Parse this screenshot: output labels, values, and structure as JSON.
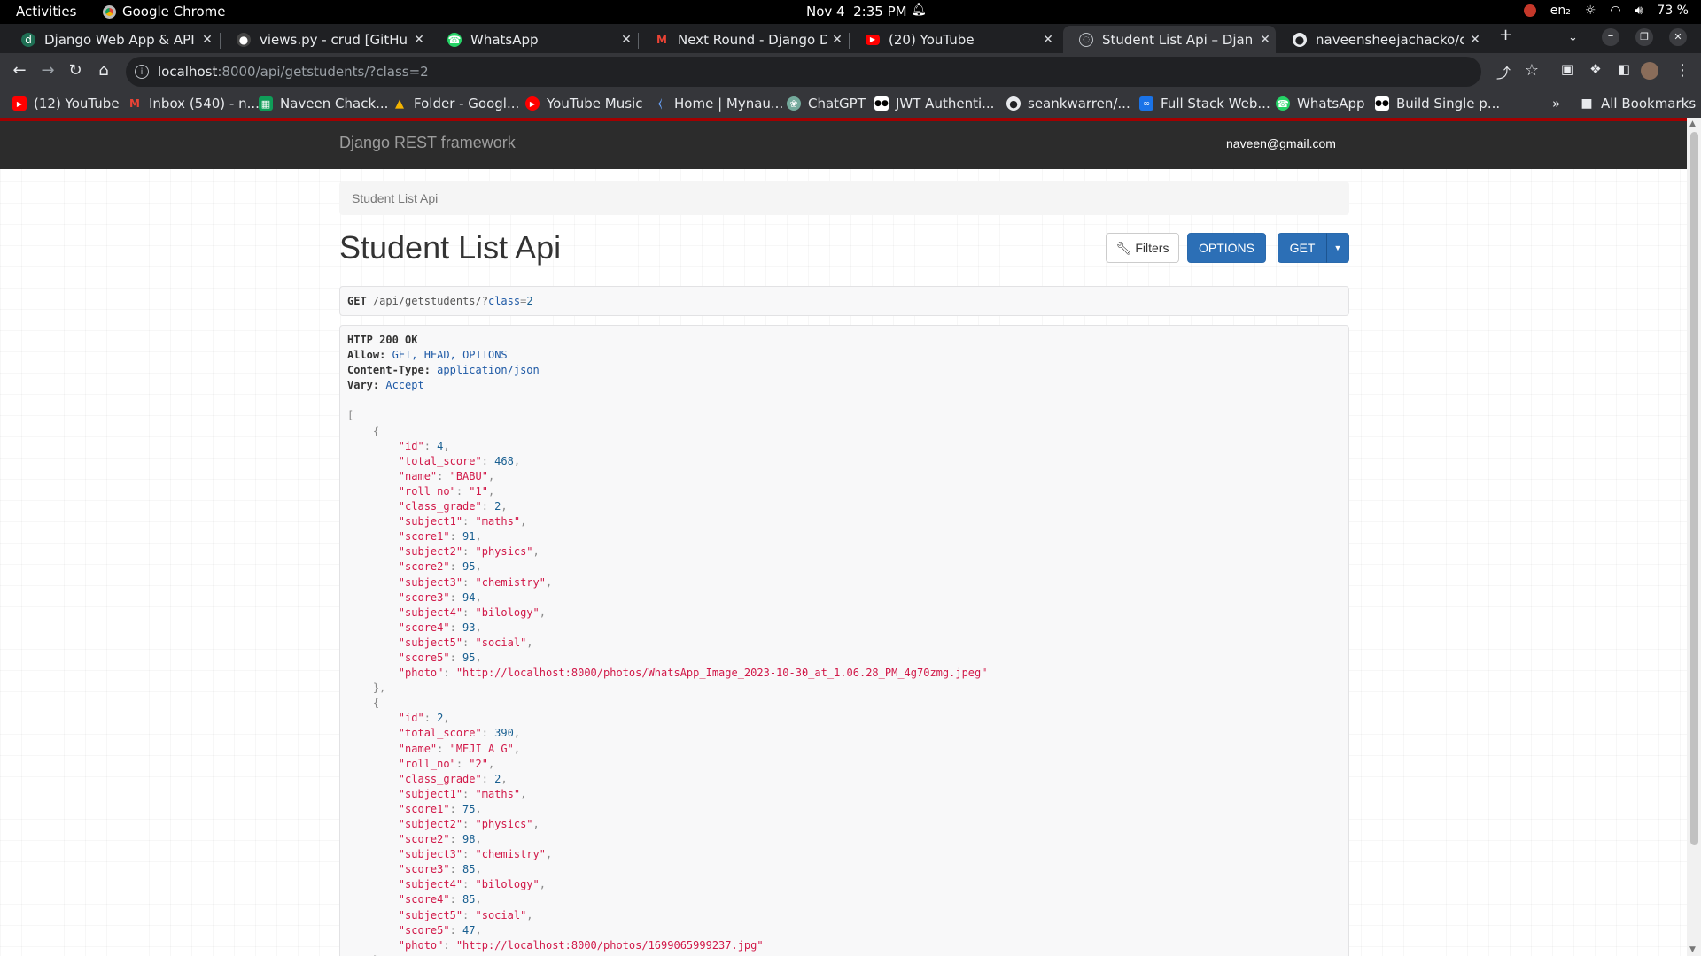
{
  "system_bar": {
    "activities": "Activities",
    "app": "Google Chrome",
    "date": "Nov 4",
    "time": "2:35 PM",
    "lang": "en₂",
    "battery": "73 %"
  },
  "tabs": [
    {
      "title": "Django Web App & API",
      "icon": "django-icon",
      "active": false
    },
    {
      "title": "views.py - crud [GitHub] -",
      "icon": "github-icon",
      "active": false
    },
    {
      "title": "WhatsApp",
      "icon": "whatsapp-icon",
      "active": false
    },
    {
      "title": "Next Round - Django Dev",
      "icon": "gmail-icon",
      "active": false
    },
    {
      "title": "(20) YouTube",
      "icon": "youtube-icon",
      "active": false
    },
    {
      "title": "Student List Api – Django",
      "icon": "globe-icon",
      "active": true
    },
    {
      "title": "naveensheejachacko/cor",
      "icon": "github-icon",
      "active": false
    }
  ],
  "address_bar": {
    "host": "localhost",
    "path": ":8000/api/getstudents/?class=2"
  },
  "bookmarks": [
    {
      "label": "(12) YouTube",
      "icon": "youtube-icon",
      "color": "#ff0000"
    },
    {
      "label": "Inbox (540) - n...",
      "icon": "gmail-icon",
      "color": "#d93025"
    },
    {
      "label": "Naveen Chack...",
      "icon": "sheets-icon",
      "color": "#0f9d58"
    },
    {
      "label": "Folder - Googl...",
      "icon": "drive-icon",
      "color": "#f4b400"
    },
    {
      "label": "YouTube Music",
      "icon": "youtube-music-icon",
      "color": "#ff0000"
    },
    {
      "label": "Home | Mynau...",
      "icon": "mynaukri-icon",
      "color": "#3b82f6"
    },
    {
      "label": "ChatGPT",
      "icon": "chatgpt-icon",
      "color": "#74aa9c"
    },
    {
      "label": "JWT Authenti...",
      "icon": "medium-icon",
      "color": "#000000"
    },
    {
      "label": "seankwarren/...",
      "icon": "github-icon",
      "color": "#000000"
    },
    {
      "label": "Full Stack Web...",
      "icon": "coursera-icon",
      "color": "#1a73e8"
    },
    {
      "label": "WhatsApp",
      "icon": "whatsapp-icon",
      "color": "#25d366"
    },
    {
      "label": "Build Single p...",
      "icon": "medium-icon",
      "color": "#000000"
    }
  ],
  "all_bookmarks": "All Bookmarks",
  "drf": {
    "brand": "Django REST framework",
    "user": "naveen@gmail.com",
    "breadcrumb": "Student List Api",
    "title": "Student List Api",
    "filters_label": "Filters",
    "options_label": "OPTIONS",
    "get_label": "GET",
    "request": {
      "method": "GET",
      "path": "/api/getstudents/?",
      "param_key": "class",
      "param_val": "2"
    },
    "response": {
      "status": "HTTP 200 OK",
      "headers": [
        {
          "name": "Allow:",
          "value": "GET, HEAD, OPTIONS"
        },
        {
          "name": "Content-Type:",
          "value": "application/json"
        },
        {
          "name": "Vary:",
          "value": "Accept"
        }
      ],
      "students": [
        {
          "id": "4",
          "total_score": "468",
          "name": "\"BABU\"",
          "roll_no": "\"1\"",
          "class_grade": "2",
          "subject1": "\"maths\"",
          "score1": "91",
          "subject2": "\"physics\"",
          "score2": "95",
          "subject3": "\"chemistry\"",
          "score3": "94",
          "subject4": "\"bilology\"",
          "score4": "93",
          "subject5": "\"social\"",
          "score5": "95",
          "photo": "\"http://localhost:8000/photos/WhatsApp_Image_2023-10-30_at_1.06.28_PM_4g70zmg.jpeg\""
        },
        {
          "id": "2",
          "total_score": "390",
          "name": "\"MEJI A G\"",
          "roll_no": "\"2\"",
          "class_grade": "2",
          "subject1": "\"maths\"",
          "score1": "75",
          "subject2": "\"physics\"",
          "score2": "98",
          "subject3": "\"chemistry\"",
          "score3": "85",
          "subject4": "\"bilology\"",
          "score4": "85",
          "subject5": "\"social\"",
          "score5": "47",
          "photo": "\"http://localhost:8000/photos/1699065999237.jpg\""
        }
      ]
    }
  }
}
